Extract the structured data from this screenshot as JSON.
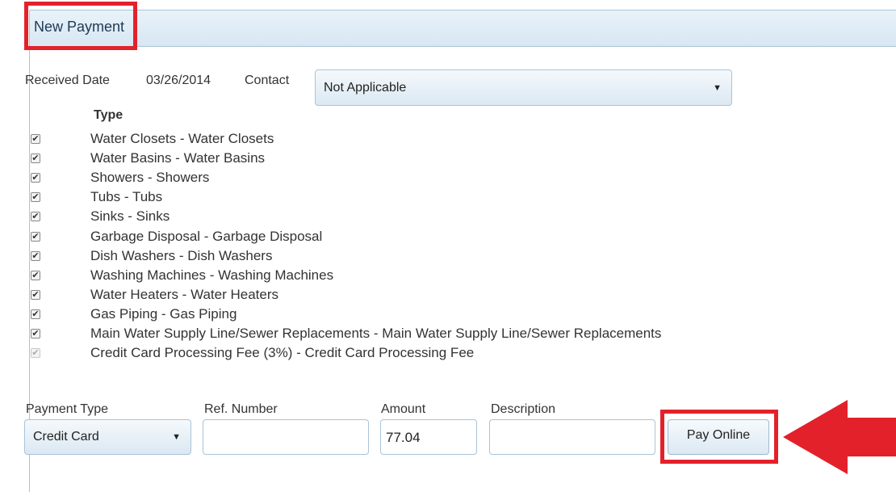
{
  "panel": {
    "title": "New Payment"
  },
  "form": {
    "received_date_label": "Received Date",
    "received_date_value": "03/26/2014",
    "contact_label": "Contact",
    "contact_value": "Not Applicable",
    "type_header": "Type",
    "items": [
      {
        "label": "Water Closets - Water Closets",
        "checked": true,
        "disabled": false
      },
      {
        "label": "Water Basins - Water Basins",
        "checked": true,
        "disabled": false
      },
      {
        "label": "Showers - Showers",
        "checked": true,
        "disabled": false
      },
      {
        "label": "Tubs - Tubs",
        "checked": true,
        "disabled": false
      },
      {
        "label": "Sinks - Sinks",
        "checked": true,
        "disabled": false
      },
      {
        "label": "Garbage Disposal - Garbage Disposal",
        "checked": true,
        "disabled": false
      },
      {
        "label": "Dish Washers - Dish Washers",
        "checked": true,
        "disabled": false
      },
      {
        "label": "Washing Machines - Washing Machines",
        "checked": true,
        "disabled": false
      },
      {
        "label": "Water Heaters - Water Heaters",
        "checked": true,
        "disabled": false
      },
      {
        "label": "Gas Piping - Gas Piping",
        "checked": true,
        "disabled": false
      },
      {
        "label": "Main Water Supply Line/Sewer Replacements - Main Water Supply Line/Sewer Replacements",
        "checked": true,
        "disabled": false
      },
      {
        "label": "Credit Card Processing Fee (3%) - Credit Card Processing Fee",
        "checked": true,
        "disabled": true
      }
    ],
    "payment_type_label": "Payment Type",
    "payment_type_value": "Credit Card",
    "ref_number_label": "Ref. Number",
    "ref_number_value": "",
    "amount_label": "Amount",
    "amount_value": "77.04",
    "description_label": "Description",
    "description_value": "",
    "pay_button_label": "Pay Online"
  },
  "annotations": {
    "highlight_color": "#e3212b",
    "arrow_color": "#e3212b"
  }
}
